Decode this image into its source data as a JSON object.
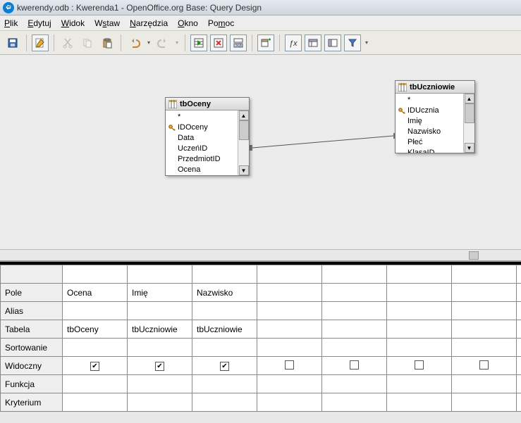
{
  "title": "kwerendy.odb : Kwerenda1 - OpenOffice.org Base: Query Design",
  "menu": {
    "plik": "Plik",
    "edytuj": "Edytuj",
    "widok": "Widok",
    "wstaw": "Wstaw",
    "narzedzia": "Narzędzia",
    "okno": "Okno",
    "pomoc": "Pomoc"
  },
  "tables": {
    "oceny": {
      "title": "tbOceny",
      "fields": [
        "*",
        "IDOceny",
        "Data",
        "UczeńID",
        "PrzedmiotID",
        "Ocena"
      ],
      "key_index": 1
    },
    "uczniowie": {
      "title": "tbUczniowie",
      "fields": [
        "*",
        "IDUcznia",
        "Imię",
        "Nazwisko",
        "Płeć",
        "KlasaID"
      ],
      "key_index": 1
    }
  },
  "grid": {
    "headers": {
      "pole": "Pole",
      "alias": "Alias",
      "tabela": "Tabela",
      "sortowanie": "Sortowanie",
      "widoczny": "Widoczny",
      "funkcja": "Funkcja",
      "kryterium": "Kryterium"
    },
    "columns": [
      {
        "pole": "Ocena",
        "alias": "",
        "tabela": "tbOceny",
        "sort": "",
        "visible": true,
        "funkcja": "",
        "kryterium": ""
      },
      {
        "pole": "Imię",
        "alias": "",
        "tabela": "tbUczniowie",
        "sort": "",
        "visible": true,
        "funkcja": "",
        "kryterium": ""
      },
      {
        "pole": "Nazwisko",
        "alias": "",
        "tabela": "tbUczniowie",
        "sort": "",
        "visible": true,
        "funkcja": "",
        "kryterium": ""
      },
      {
        "pole": "",
        "alias": "",
        "tabela": "",
        "sort": "",
        "visible": false,
        "funkcja": "",
        "kryterium": ""
      },
      {
        "pole": "",
        "alias": "",
        "tabela": "",
        "sort": "",
        "visible": false,
        "funkcja": "",
        "kryterium": ""
      },
      {
        "pole": "",
        "alias": "",
        "tabela": "",
        "sort": "",
        "visible": false,
        "funkcja": "",
        "kryterium": ""
      },
      {
        "pole": "",
        "alias": "",
        "tabela": "",
        "sort": "",
        "visible": false,
        "funkcja": "",
        "kryterium": ""
      },
      {
        "pole": "",
        "alias": "",
        "tabela": "",
        "sort": "",
        "visible": false,
        "funkcja": "",
        "kryterium": ""
      }
    ]
  }
}
